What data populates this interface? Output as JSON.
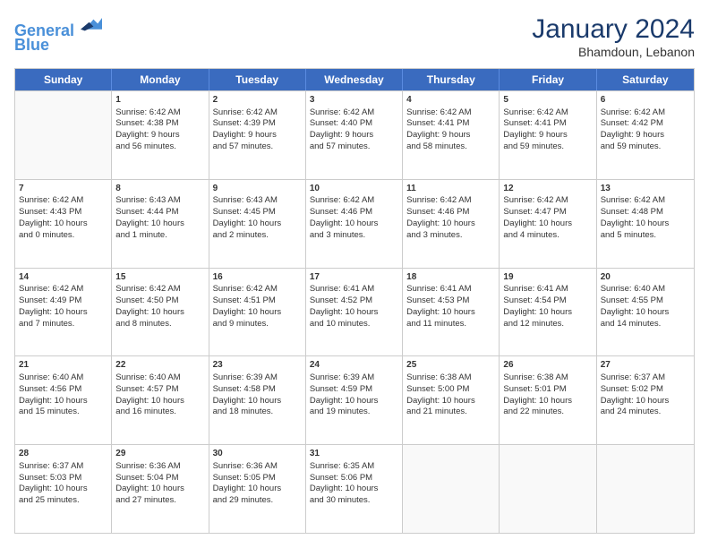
{
  "header": {
    "logo_line1": "General",
    "logo_line2": "Blue",
    "month_year": "January 2024",
    "location": "Bhamdoun, Lebanon"
  },
  "weekdays": [
    "Sunday",
    "Monday",
    "Tuesday",
    "Wednesday",
    "Thursday",
    "Friday",
    "Saturday"
  ],
  "rows": [
    [
      {
        "day": "",
        "lines": []
      },
      {
        "day": "1",
        "lines": [
          "Sunrise: 6:42 AM",
          "Sunset: 4:38 PM",
          "Daylight: 9 hours",
          "and 56 minutes."
        ]
      },
      {
        "day": "2",
        "lines": [
          "Sunrise: 6:42 AM",
          "Sunset: 4:39 PM",
          "Daylight: 9 hours",
          "and 57 minutes."
        ]
      },
      {
        "day": "3",
        "lines": [
          "Sunrise: 6:42 AM",
          "Sunset: 4:40 PM",
          "Daylight: 9 hours",
          "and 57 minutes."
        ]
      },
      {
        "day": "4",
        "lines": [
          "Sunrise: 6:42 AM",
          "Sunset: 4:41 PM",
          "Daylight: 9 hours",
          "and 58 minutes."
        ]
      },
      {
        "day": "5",
        "lines": [
          "Sunrise: 6:42 AM",
          "Sunset: 4:41 PM",
          "Daylight: 9 hours",
          "and 59 minutes."
        ]
      },
      {
        "day": "6",
        "lines": [
          "Sunrise: 6:42 AM",
          "Sunset: 4:42 PM",
          "Daylight: 9 hours",
          "and 59 minutes."
        ]
      }
    ],
    [
      {
        "day": "7",
        "lines": [
          "Sunrise: 6:42 AM",
          "Sunset: 4:43 PM",
          "Daylight: 10 hours",
          "and 0 minutes."
        ]
      },
      {
        "day": "8",
        "lines": [
          "Sunrise: 6:43 AM",
          "Sunset: 4:44 PM",
          "Daylight: 10 hours",
          "and 1 minute."
        ]
      },
      {
        "day": "9",
        "lines": [
          "Sunrise: 6:43 AM",
          "Sunset: 4:45 PM",
          "Daylight: 10 hours",
          "and 2 minutes."
        ]
      },
      {
        "day": "10",
        "lines": [
          "Sunrise: 6:42 AM",
          "Sunset: 4:46 PM",
          "Daylight: 10 hours",
          "and 3 minutes."
        ]
      },
      {
        "day": "11",
        "lines": [
          "Sunrise: 6:42 AM",
          "Sunset: 4:46 PM",
          "Daylight: 10 hours",
          "and 3 minutes."
        ]
      },
      {
        "day": "12",
        "lines": [
          "Sunrise: 6:42 AM",
          "Sunset: 4:47 PM",
          "Daylight: 10 hours",
          "and 4 minutes."
        ]
      },
      {
        "day": "13",
        "lines": [
          "Sunrise: 6:42 AM",
          "Sunset: 4:48 PM",
          "Daylight: 10 hours",
          "and 5 minutes."
        ]
      }
    ],
    [
      {
        "day": "14",
        "lines": [
          "Sunrise: 6:42 AM",
          "Sunset: 4:49 PM",
          "Daylight: 10 hours",
          "and 7 minutes."
        ]
      },
      {
        "day": "15",
        "lines": [
          "Sunrise: 6:42 AM",
          "Sunset: 4:50 PM",
          "Daylight: 10 hours",
          "and 8 minutes."
        ]
      },
      {
        "day": "16",
        "lines": [
          "Sunrise: 6:42 AM",
          "Sunset: 4:51 PM",
          "Daylight: 10 hours",
          "and 9 minutes."
        ]
      },
      {
        "day": "17",
        "lines": [
          "Sunrise: 6:41 AM",
          "Sunset: 4:52 PM",
          "Daylight: 10 hours",
          "and 10 minutes."
        ]
      },
      {
        "day": "18",
        "lines": [
          "Sunrise: 6:41 AM",
          "Sunset: 4:53 PM",
          "Daylight: 10 hours",
          "and 11 minutes."
        ]
      },
      {
        "day": "19",
        "lines": [
          "Sunrise: 6:41 AM",
          "Sunset: 4:54 PM",
          "Daylight: 10 hours",
          "and 12 minutes."
        ]
      },
      {
        "day": "20",
        "lines": [
          "Sunrise: 6:40 AM",
          "Sunset: 4:55 PM",
          "Daylight: 10 hours",
          "and 14 minutes."
        ]
      }
    ],
    [
      {
        "day": "21",
        "lines": [
          "Sunrise: 6:40 AM",
          "Sunset: 4:56 PM",
          "Daylight: 10 hours",
          "and 15 minutes."
        ]
      },
      {
        "day": "22",
        "lines": [
          "Sunrise: 6:40 AM",
          "Sunset: 4:57 PM",
          "Daylight: 10 hours",
          "and 16 minutes."
        ]
      },
      {
        "day": "23",
        "lines": [
          "Sunrise: 6:39 AM",
          "Sunset: 4:58 PM",
          "Daylight: 10 hours",
          "and 18 minutes."
        ]
      },
      {
        "day": "24",
        "lines": [
          "Sunrise: 6:39 AM",
          "Sunset: 4:59 PM",
          "Daylight: 10 hours",
          "and 19 minutes."
        ]
      },
      {
        "day": "25",
        "lines": [
          "Sunrise: 6:38 AM",
          "Sunset: 5:00 PM",
          "Daylight: 10 hours",
          "and 21 minutes."
        ]
      },
      {
        "day": "26",
        "lines": [
          "Sunrise: 6:38 AM",
          "Sunset: 5:01 PM",
          "Daylight: 10 hours",
          "and 22 minutes."
        ]
      },
      {
        "day": "27",
        "lines": [
          "Sunrise: 6:37 AM",
          "Sunset: 5:02 PM",
          "Daylight: 10 hours",
          "and 24 minutes."
        ]
      }
    ],
    [
      {
        "day": "28",
        "lines": [
          "Sunrise: 6:37 AM",
          "Sunset: 5:03 PM",
          "Daylight: 10 hours",
          "and 25 minutes."
        ]
      },
      {
        "day": "29",
        "lines": [
          "Sunrise: 6:36 AM",
          "Sunset: 5:04 PM",
          "Daylight: 10 hours",
          "and 27 minutes."
        ]
      },
      {
        "day": "30",
        "lines": [
          "Sunrise: 6:36 AM",
          "Sunset: 5:05 PM",
          "Daylight: 10 hours",
          "and 29 minutes."
        ]
      },
      {
        "day": "31",
        "lines": [
          "Sunrise: 6:35 AM",
          "Sunset: 5:06 PM",
          "Daylight: 10 hours",
          "and 30 minutes."
        ]
      },
      {
        "day": "",
        "lines": []
      },
      {
        "day": "",
        "lines": []
      },
      {
        "day": "",
        "lines": []
      }
    ]
  ]
}
